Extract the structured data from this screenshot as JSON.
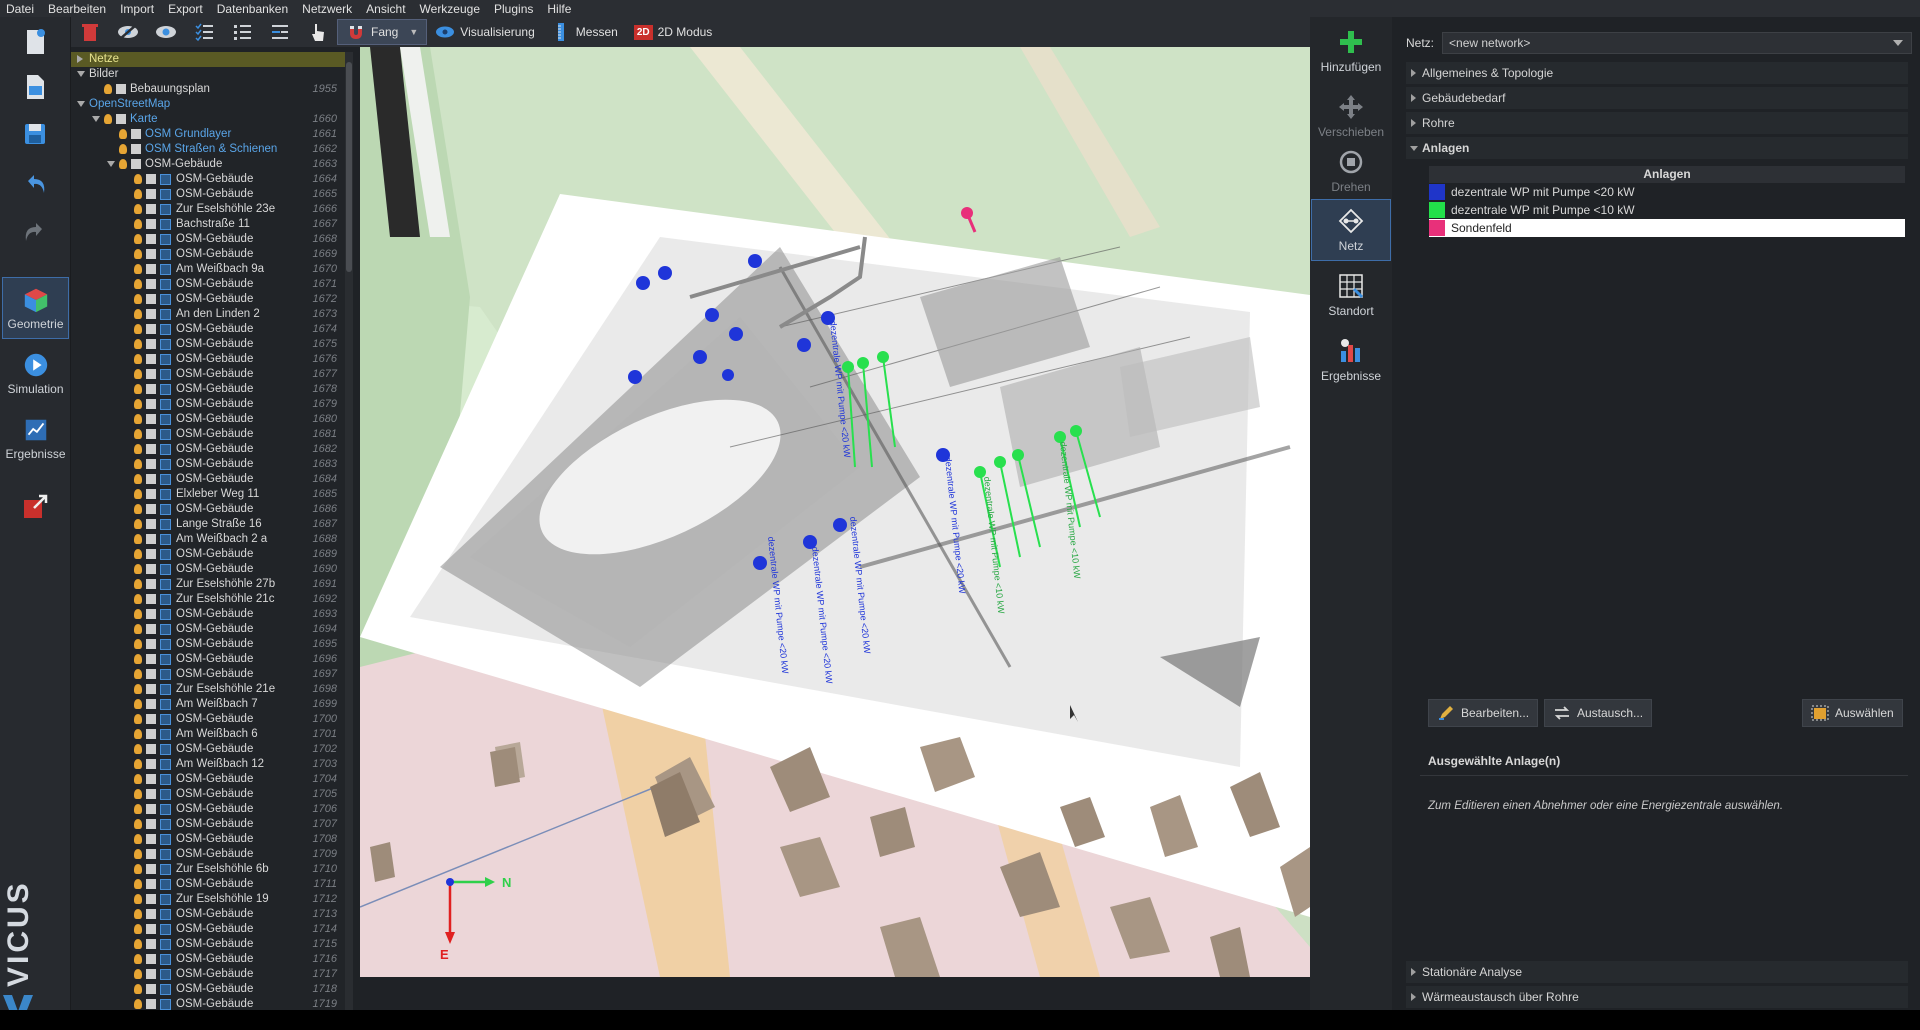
{
  "menubar": {
    "items": [
      "Datei",
      "Bearbeiten",
      "Import",
      "Export",
      "Datenbanken",
      "Netzwerk",
      "Ansicht",
      "Werkzeuge",
      "Plugins",
      "Hilfe"
    ]
  },
  "nav": {
    "geometry": "Geometrie",
    "simulation": "Simulation",
    "results": "Ergebnisse"
  },
  "branding": {
    "logo_text": "VICUS"
  },
  "toolbar": {
    "snap": "Fang",
    "visualization": "Visualisierung",
    "measure": "Messen",
    "mode_2d": "2D Modus",
    "mode_2d_icon_text": "2D"
  },
  "tree": {
    "top": [
      {
        "label": "Netze",
        "level": 0,
        "kind": "collapsed",
        "highlight": true,
        "color": "normal"
      },
      {
        "label": "Bilder",
        "level": 0,
        "kind": "expanded",
        "color": "normal"
      },
      {
        "label": "Bebauungsplan",
        "level": 1,
        "index": "1955",
        "kind": "item",
        "color": "normal"
      },
      {
        "label": "OpenStreetMap",
        "level": 0,
        "kind": "expanded",
        "color": "blue"
      },
      {
        "label": "Karte",
        "level": 1,
        "index": "1660",
        "kind": "expanded",
        "color": "blue"
      },
      {
        "label": "OSM Grundlayer",
        "level": 2,
        "index": "1661",
        "kind": "bulb",
        "color": "blue"
      },
      {
        "label": "OSM Straßen & Schienen",
        "level": 2,
        "index": "1662",
        "kind": "bulb",
        "color": "blue"
      },
      {
        "label": "OSM-Gebäude",
        "level": 2,
        "index": "1663",
        "kind": "expanded",
        "color": "normal"
      }
    ],
    "buildings": [
      {
        "label": "OSM-Gebäude",
        "index": "1664"
      },
      {
        "label": "OSM-Gebäude",
        "index": "1665"
      },
      {
        "label": "Zur Eselshöhle 23e",
        "index": "1666"
      },
      {
        "label": "Bachstraße 11",
        "index": "1667"
      },
      {
        "label": "OSM-Gebäude",
        "index": "1668"
      },
      {
        "label": "OSM-Gebäude",
        "index": "1669"
      },
      {
        "label": "Am Weißbach 9a",
        "index": "1670"
      },
      {
        "label": "OSM-Gebäude",
        "index": "1671"
      },
      {
        "label": "OSM-Gebäude",
        "index": "1672"
      },
      {
        "label": "An den Linden 2",
        "index": "1673"
      },
      {
        "label": "OSM-Gebäude",
        "index": "1674"
      },
      {
        "label": "OSM-Gebäude",
        "index": "1675"
      },
      {
        "label": "OSM-Gebäude",
        "index": "1676"
      },
      {
        "label": "OSM-Gebäude",
        "index": "1677"
      },
      {
        "label": "OSM-Gebäude",
        "index": "1678"
      },
      {
        "label": "OSM-Gebäude",
        "index": "1679"
      },
      {
        "label": "OSM-Gebäude",
        "index": "1680"
      },
      {
        "label": "OSM-Gebäude",
        "index": "1681"
      },
      {
        "label": "OSM-Gebäude",
        "index": "1682"
      },
      {
        "label": "OSM-Gebäude",
        "index": "1683"
      },
      {
        "label": "OSM-Gebäude",
        "index": "1684"
      },
      {
        "label": "Elxleber Weg 11",
        "index": "1685"
      },
      {
        "label": "OSM-Gebäude",
        "index": "1686"
      },
      {
        "label": "Lange Straße 16",
        "index": "1687"
      },
      {
        "label": "Am Weißbach 2 a",
        "index": "1688"
      },
      {
        "label": "OSM-Gebäude",
        "index": "1689"
      },
      {
        "label": "OSM-Gebäude",
        "index": "1690"
      },
      {
        "label": "Zur Eselshöhle 27b",
        "index": "1691"
      },
      {
        "label": "Zur Eselshöhle 21c",
        "index": "1692"
      },
      {
        "label": "OSM-Gebäude",
        "index": "1693"
      },
      {
        "label": "OSM-Gebäude",
        "index": "1694"
      },
      {
        "label": "OSM-Gebäude",
        "index": "1695"
      },
      {
        "label": "OSM-Gebäude",
        "index": "1696"
      },
      {
        "label": "OSM-Gebäude",
        "index": "1697"
      },
      {
        "label": "Zur Eselshöhle 21e",
        "index": "1698"
      },
      {
        "label": "Am Weißbach 7",
        "index": "1699"
      },
      {
        "label": "OSM-Gebäude",
        "index": "1700"
      },
      {
        "label": "Am Weißbach 6",
        "index": "1701"
      },
      {
        "label": "OSM-Gebäude",
        "index": "1702"
      },
      {
        "label": "Am Weißbach 12",
        "index": "1703"
      },
      {
        "label": "OSM-Gebäude",
        "index": "1704"
      },
      {
        "label": "OSM-Gebäude",
        "index": "1705"
      },
      {
        "label": "OSM-Gebäude",
        "index": "1706"
      },
      {
        "label": "OSM-Gebäude",
        "index": "1707"
      },
      {
        "label": "OSM-Gebäude",
        "index": "1708"
      },
      {
        "label": "OSM-Gebäude",
        "index": "1709"
      },
      {
        "label": "Zur Eselshöhle 6b",
        "index": "1710"
      },
      {
        "label": "OSM-Gebäude",
        "index": "1711"
      },
      {
        "label": "Zur Eselshöhle 19",
        "index": "1712"
      },
      {
        "label": "OSM-Gebäude",
        "index": "1713"
      },
      {
        "label": "OSM-Gebäude",
        "index": "1714"
      },
      {
        "label": "OSM-Gebäude",
        "index": "1715"
      },
      {
        "label": "OSM-Gebäude",
        "index": "1716"
      },
      {
        "label": "OSM-Gebäude",
        "index": "1717"
      },
      {
        "label": "OSM-Gebäude",
        "index": "1718"
      },
      {
        "label": "OSM-Gebäude",
        "index": "1719"
      }
    ]
  },
  "viewport": {
    "axis_n": "N",
    "axis_e": "E",
    "labels_blue": [
      "dezentrale WP mit Pumpe <20 kW"
    ],
    "labels_green": [
      "dezentrale WP mit Pumpe <10 kW"
    ]
  },
  "tools": {
    "add": "Hinzufügen",
    "move": "Verschieben",
    "rotate": "Drehen",
    "network": "Netz",
    "site": "Standort",
    "results": "Ergebnisse"
  },
  "props": {
    "net_label": "Netz:",
    "net_value": "<new network>",
    "sections": {
      "general": "Allgemeines & Topologie",
      "demand": "Gebäudebedarf",
      "pipes": "Rohre",
      "plants": "Anlagen",
      "stationary": "Stationäre Analyse",
      "heat_exchange": "Wärmeaustausch über Rohre"
    },
    "table_header": "Anlagen",
    "plants": [
      {
        "name": "dezentrale WP mit Pumpe <20 kW",
        "color": "#1f35c9"
      },
      {
        "name": "dezentrale WP mit Pumpe <10 kW",
        "color": "#22e04a"
      },
      {
        "name": "Sondenfeld",
        "color": "#e8307a"
      }
    ],
    "buttons": {
      "edit": "Bearbeiten...",
      "exchange": "Austausch...",
      "select": "Auswählen"
    },
    "selected_title": "Ausgewählte Anlage(n)",
    "hint": "Zum Editieren einen Abnehmer oder eine Energiezentrale auswählen."
  }
}
